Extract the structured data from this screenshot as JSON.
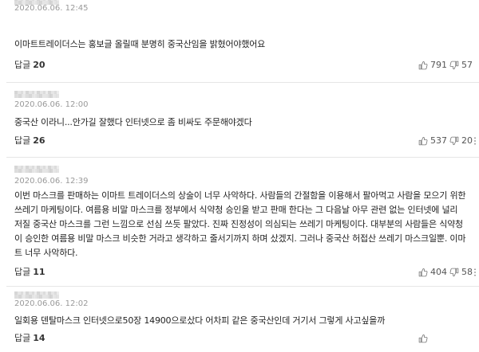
{
  "comments": [
    {
      "timestamp": "2020.06.06. 12:45",
      "text_lines": [
        "이마트트레이더스는 홍보글 올릴때 분명히 중국산임을 밝혔어야했어요"
      ],
      "reply_label": "답글",
      "reply_count": "20",
      "likes": "791",
      "dislikes": "57"
    },
    {
      "timestamp": "2020.06.06. 12:00",
      "text_lines": [
        "중국산 이라니...안가길 잘했다 인터넷으로 좀 비싸도 주문해야겠다"
      ],
      "reply_label": "답글",
      "reply_count": "26",
      "likes": "537",
      "dislikes": "20"
    },
    {
      "timestamp": "2020.06.06. 12:39",
      "text_lines": [
        "이번 마스크를 판매하는 이마트 트레이더스의 상술이 너무 사악하다. 사람들의 간절함을 이용해서 팔아먹고 사람을 모으기 위한",
        "쓰레기 마케팅이다. 여름용 비말 마스크를 정부에서 식약청 승인을 받고 판매 한다는 그 다음날 아무 관련 없는 인터넷에 널리",
        "저질 중국산 마스크를 그런 느낌으로 선심 쓰듯 팔았다. 진짜 진정성이 의심되는 쓰레기 마케팅이다. 대부분의 사람들은 식약청",
        "이 승인한 여름용 비말 마스크 비슷한 거라고 생각하고 줄서기까지 하며 샀겠지. 그러나 중국산 허접산 쓰레기 마스크일뿐. 이마",
        "트 너무 사악하다."
      ],
      "reply_label": "답글",
      "reply_count": "11",
      "likes": "404",
      "dislikes": "58"
    },
    {
      "timestamp": "2020.06.06. 12:02",
      "text_lines": [
        "일회용 덴탈마스크 인터넷으로50장 14900으로샀다 어차피 같은 중국산인데 거기서 그렇게 사고싶을까"
      ],
      "reply_label": "답글",
      "reply_count": "14"
    }
  ],
  "icons": {
    "like": "thumbs-up-icon",
    "dislike": "thumbs-down-icon",
    "more": "more-vertical-icon"
  },
  "colors": {
    "text": "#222222",
    "meta": "#999999",
    "divider": "#e6e6e6",
    "icon": "#777777"
  }
}
